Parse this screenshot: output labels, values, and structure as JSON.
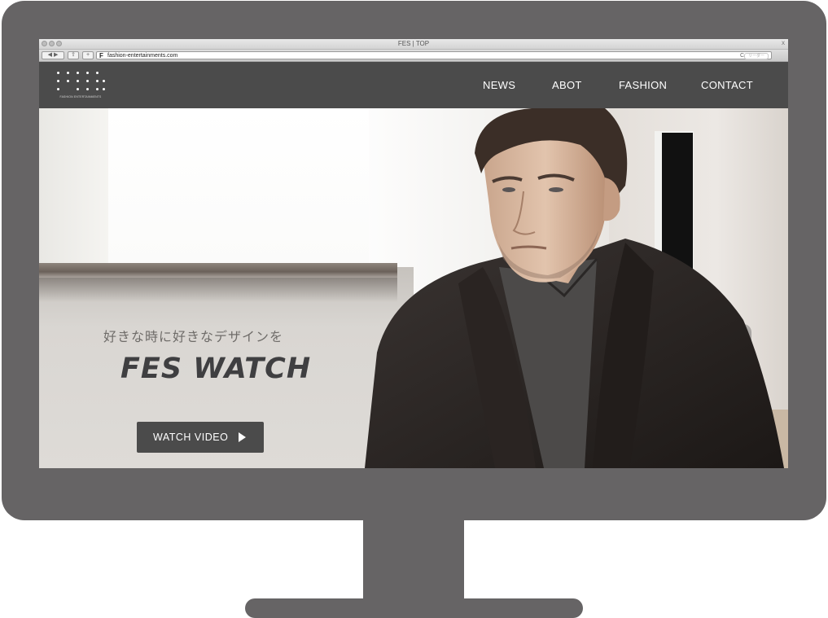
{
  "browser": {
    "window_title": "FES | TOP",
    "url": "fashion-entertainments.com",
    "favicon_letter": "F",
    "search_placeholder": "リーダー",
    "reload_glyph": "C",
    "close_glyph": "x"
  },
  "site": {
    "logo_text": "FASHION ENTERTAINMENTS",
    "nav": [
      "NEWS",
      "ABOT",
      "FASHION",
      "CONTACT"
    ]
  },
  "hero": {
    "tagline": "好きな時に好きなデザインを",
    "title": "FES WATCH",
    "button_label": "WATCH VIDEO"
  },
  "colors": {
    "frame": "#666465",
    "header": "#4b4b4b",
    "button": "#4b4b4b",
    "title": "#3f3f41"
  }
}
